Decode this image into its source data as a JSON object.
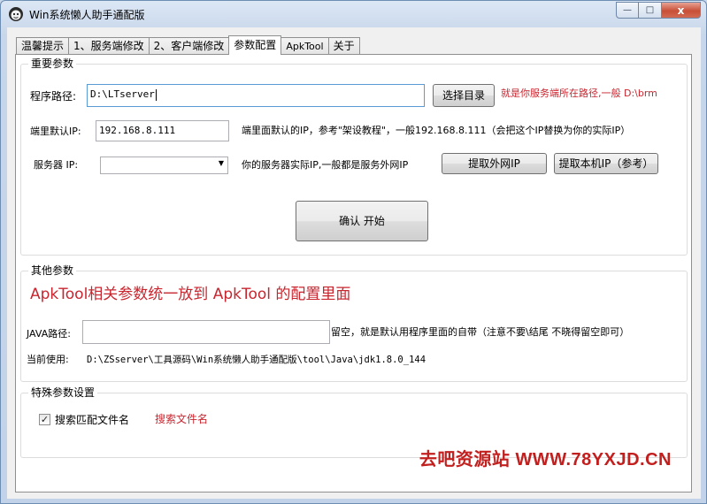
{
  "window": {
    "title": "Win系统懒人助手通配版",
    "controls": {
      "minimize": "—",
      "maximize": "□",
      "close": "x"
    }
  },
  "tabs": [
    {
      "label": "温馨提示"
    },
    {
      "label": "1、服务端修改"
    },
    {
      "label": "2、客户端修改"
    },
    {
      "label": "参数配置"
    },
    {
      "label": "ApkTool"
    },
    {
      "label": "关于"
    }
  ],
  "important": {
    "title": "重要参数",
    "program_path_label": "程序路径:",
    "program_path_value": "D:\\LTserver",
    "browse_button": "选择目录",
    "program_path_hint": "就是你服务端所在路径,一般 D:\\brm",
    "default_ip_label": "端里默认IP:",
    "default_ip_value": "192.168.8.111",
    "default_ip_hint": "端里面默认的IP，参考\"架设教程\"，一般192.168.8.111（会把这个IP替换为你的实际IP）",
    "server_ip_label": "服务器 IP:",
    "server_ip_value": "",
    "server_ip_hint": "你的服务器实际IP,一般都是服务外网IP",
    "get_external_ip_button": "提取外网IP",
    "get_local_ip_button": "提取本机IP（参考）",
    "confirm_button": "确认 开始"
  },
  "other": {
    "title": "其他参数",
    "notice": "ApkTool相关参数统一放到  ApkTool 的配置里面",
    "java_path_label": "JAVA路径:",
    "java_path_value": "",
    "java_path_hint": "留空，就是默认用程序里面的自带（注意不要\\结尾 不晓得留空即可）",
    "current_use_label": "当前使用:",
    "current_use_value": "D:\\ZSserver\\工具源码\\Win系统懒人助手通配版\\tool\\Java\\jdk1.8.0_144"
  },
  "special": {
    "title": "特殊参数设置",
    "search_match_label": "搜索匹配文件名",
    "search_match_checked": true,
    "search_filename_link": "搜索文件名"
  },
  "watermark": "去吧资源站 WWW.78YXJD.CN",
  "colors": {
    "accent_red": "#c8262f",
    "watermark_red": "#c21f1f"
  }
}
